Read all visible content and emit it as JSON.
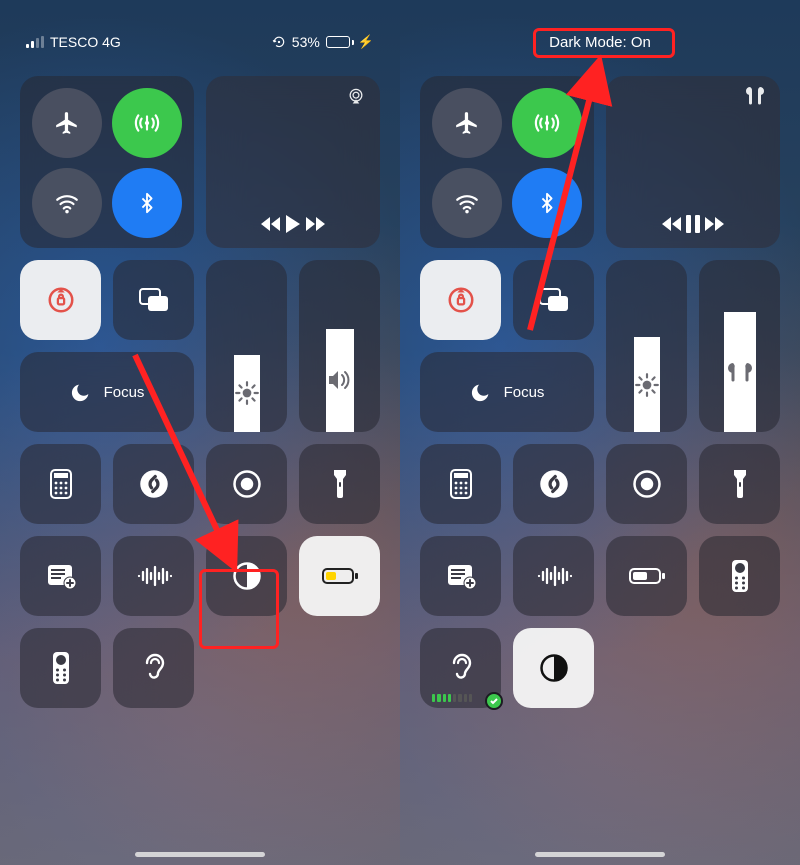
{
  "left": {
    "status": {
      "carrier": "TESCO 4G",
      "battery_pct": "53%"
    },
    "focus": "Focus",
    "brightness_pct": 45,
    "volume_pct": 60,
    "battery_widget_pct": 35,
    "media_playing": false,
    "dark_mode_highlighted": true
  },
  "right": {
    "banner": "Dark Mode: On",
    "focus": "Focus",
    "brightness_pct": 55,
    "volume_pct": 70,
    "battery_widget_pct": 50,
    "media_playing": true,
    "dark_mode_on": true
  },
  "colors": {
    "annotation": "#f22222",
    "toggle_green": "#3cc84d",
    "toggle_blue": "#1f7cf4",
    "battery_yellow": "#ffd400"
  },
  "icon_names": {
    "airplane": "airplane-icon",
    "cellular": "cellular-data-icon",
    "wifi": "wifi-icon",
    "bluetooth": "bluetooth-icon",
    "airplay": "airplay-icon",
    "airpods": "airpods-icon",
    "rewind": "rewind-icon",
    "play": "play-icon",
    "pause": "pause-icon",
    "forward": "forward-icon",
    "rotation_lock": "rotation-lock-icon",
    "screen_mirror": "screen-mirroring-icon",
    "moon": "do-not-disturb-moon-icon",
    "brightness": "brightness-icon",
    "volume": "volume-icon",
    "calculator": "calculator-icon",
    "shazam": "shazam-icon",
    "screen_record": "screen-record-icon",
    "flashlight": "flashlight-icon",
    "notes": "quick-note-icon",
    "sound_recognition": "sound-recognition-icon",
    "dark_mode": "dark-mode-icon",
    "low_power": "low-power-battery-icon",
    "tv_remote": "apple-tv-remote-icon",
    "hearing": "hearing-icon"
  }
}
